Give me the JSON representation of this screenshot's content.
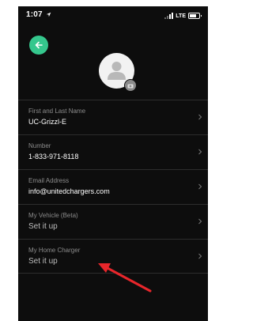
{
  "status_bar": {
    "time": "1:07",
    "network": "LTE"
  },
  "icons": {
    "back": "arrow-left-icon",
    "avatar": "user-avatar-icon",
    "camera": "camera-icon",
    "chevron": "chevron-right-icon",
    "location": "location-arrow-icon"
  },
  "colors": {
    "accent": "#35c78d",
    "background": "#0d0d0d",
    "annotation": "#e8262b"
  },
  "profile_fields": [
    {
      "label": "First and Last Name",
      "value": "UC-Grizzl-E"
    },
    {
      "label": "Number",
      "value": "1-833-971-8118"
    },
    {
      "label": "Email Address",
      "value": "info@unitedchargers.com"
    },
    {
      "label": "My Vehicle (Beta)",
      "value": "Set it up"
    },
    {
      "label": "My Home Charger",
      "value": "Set it up"
    }
  ]
}
